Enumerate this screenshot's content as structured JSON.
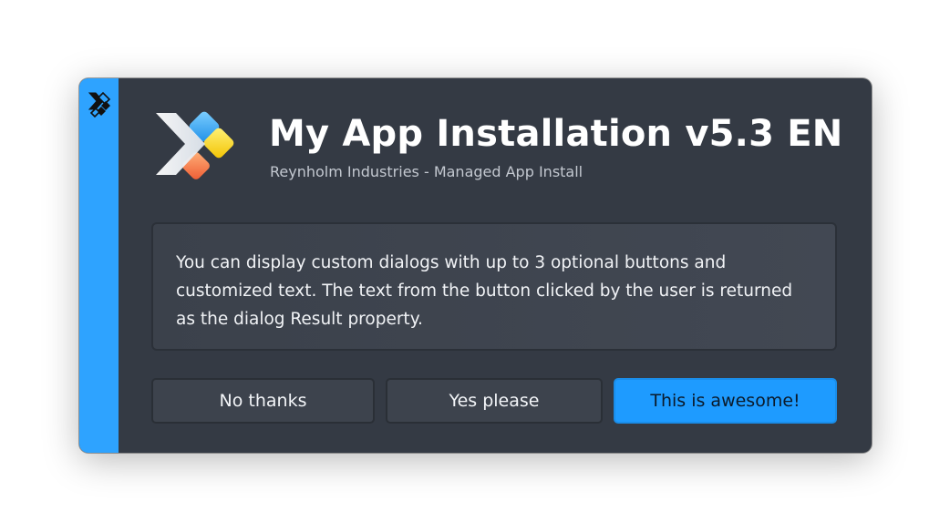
{
  "dialog": {
    "title": "My App Installation v5.3 EN",
    "subtitle": "Reynholm Industries - Managed App Install",
    "message": "You can display custom dialogs with up to 3 optional buttons and customized text. The text from the button clicked by the user is returned as the dialog Result property."
  },
  "buttons": {
    "no_label": "No thanks",
    "yes_label": "Yes please",
    "awesome_label": "This is awesome!"
  },
  "icons": {
    "sidebar": "chevron-logo-icon",
    "app": "app-logo-icon"
  },
  "colors": {
    "accent": "#2ea3ff",
    "dialog_bg": "#343a44",
    "primary_button": "#1e9bff"
  }
}
